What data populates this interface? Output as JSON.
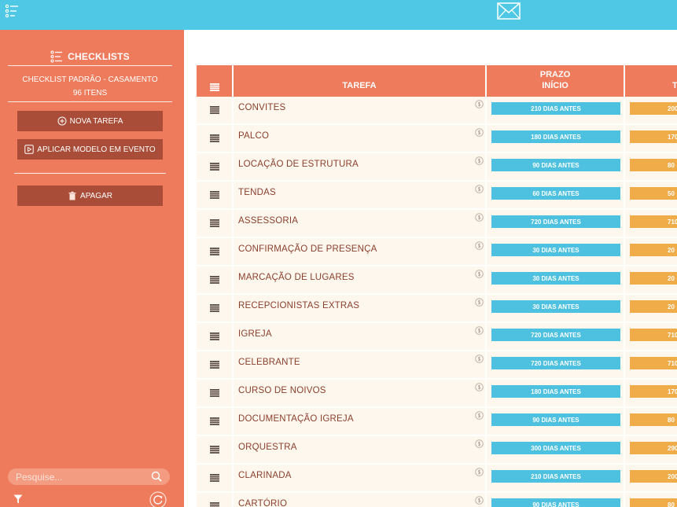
{
  "sidebar": {
    "title": "CHECKLISTS",
    "checklist_name": "CHECKLIST PADRÃO - CASAMENTO",
    "item_count": "96 ITENS",
    "new_task_label": "NOVA TAREFA",
    "apply_model_label": "APLICAR MODELO EM EVENTO",
    "delete_label": "APAGAR",
    "search_placeholder": "Pesquise..."
  },
  "colors": {
    "topbar": "#4ec8e4",
    "sidebar": "#ee7b5c",
    "button": "#a94c38",
    "start_pill": "#4ec0e0",
    "end_pill": "#f0ac48",
    "row_bg": "#fef7ee"
  },
  "table": {
    "headers": {
      "tarefa": "TAREFA",
      "prazo_line1": "PRAZO",
      "prazo_line2": "INÍCIO",
      "next_col": "T"
    },
    "rows": [
      {
        "tarefa": "CONVITES",
        "inicio": "210 DIAS ANTES",
        "fim": "200"
      },
      {
        "tarefa": "PALCO",
        "inicio": "180 DIAS ANTES",
        "fim": "170"
      },
      {
        "tarefa": "LOCAÇÃO DE ESTRUTURA",
        "inicio": "90 DIAS ANTES",
        "fim": "80"
      },
      {
        "tarefa": "TENDAS",
        "inicio": "60 DIAS ANTES",
        "fim": "50"
      },
      {
        "tarefa": "ASSESSORIA",
        "inicio": "720 DIAS ANTES",
        "fim": "710"
      },
      {
        "tarefa": "CONFIRMAÇÃO DE PRESENÇA",
        "inicio": "30 DIAS ANTES",
        "fim": "20"
      },
      {
        "tarefa": "MARCAÇÃO DE LUGARES",
        "inicio": "30 DIAS ANTES",
        "fim": "20"
      },
      {
        "tarefa": "RECEPCIONISTAS EXTRAS",
        "inicio": "30 DIAS ANTES",
        "fim": "20"
      },
      {
        "tarefa": "IGREJA",
        "inicio": "720 DIAS ANTES",
        "fim": "710"
      },
      {
        "tarefa": "CELEBRANTE",
        "inicio": "720 DIAS ANTES",
        "fim": "710"
      },
      {
        "tarefa": "CURSO DE NOIVOS",
        "inicio": "180 DIAS ANTES",
        "fim": "170"
      },
      {
        "tarefa": "DOCUMENTAÇÃO IGREJA",
        "inicio": "90 DIAS ANTES",
        "fim": "80"
      },
      {
        "tarefa": "ORQUESTRA",
        "inicio": "300 DIAS ANTES",
        "fim": "290"
      },
      {
        "tarefa": "CLARINADA",
        "inicio": "210 DIAS ANTES",
        "fim": "200"
      },
      {
        "tarefa": "CARTÓRIO",
        "inicio": "90 DIAS ANTES",
        "fim": "80"
      }
    ]
  }
}
